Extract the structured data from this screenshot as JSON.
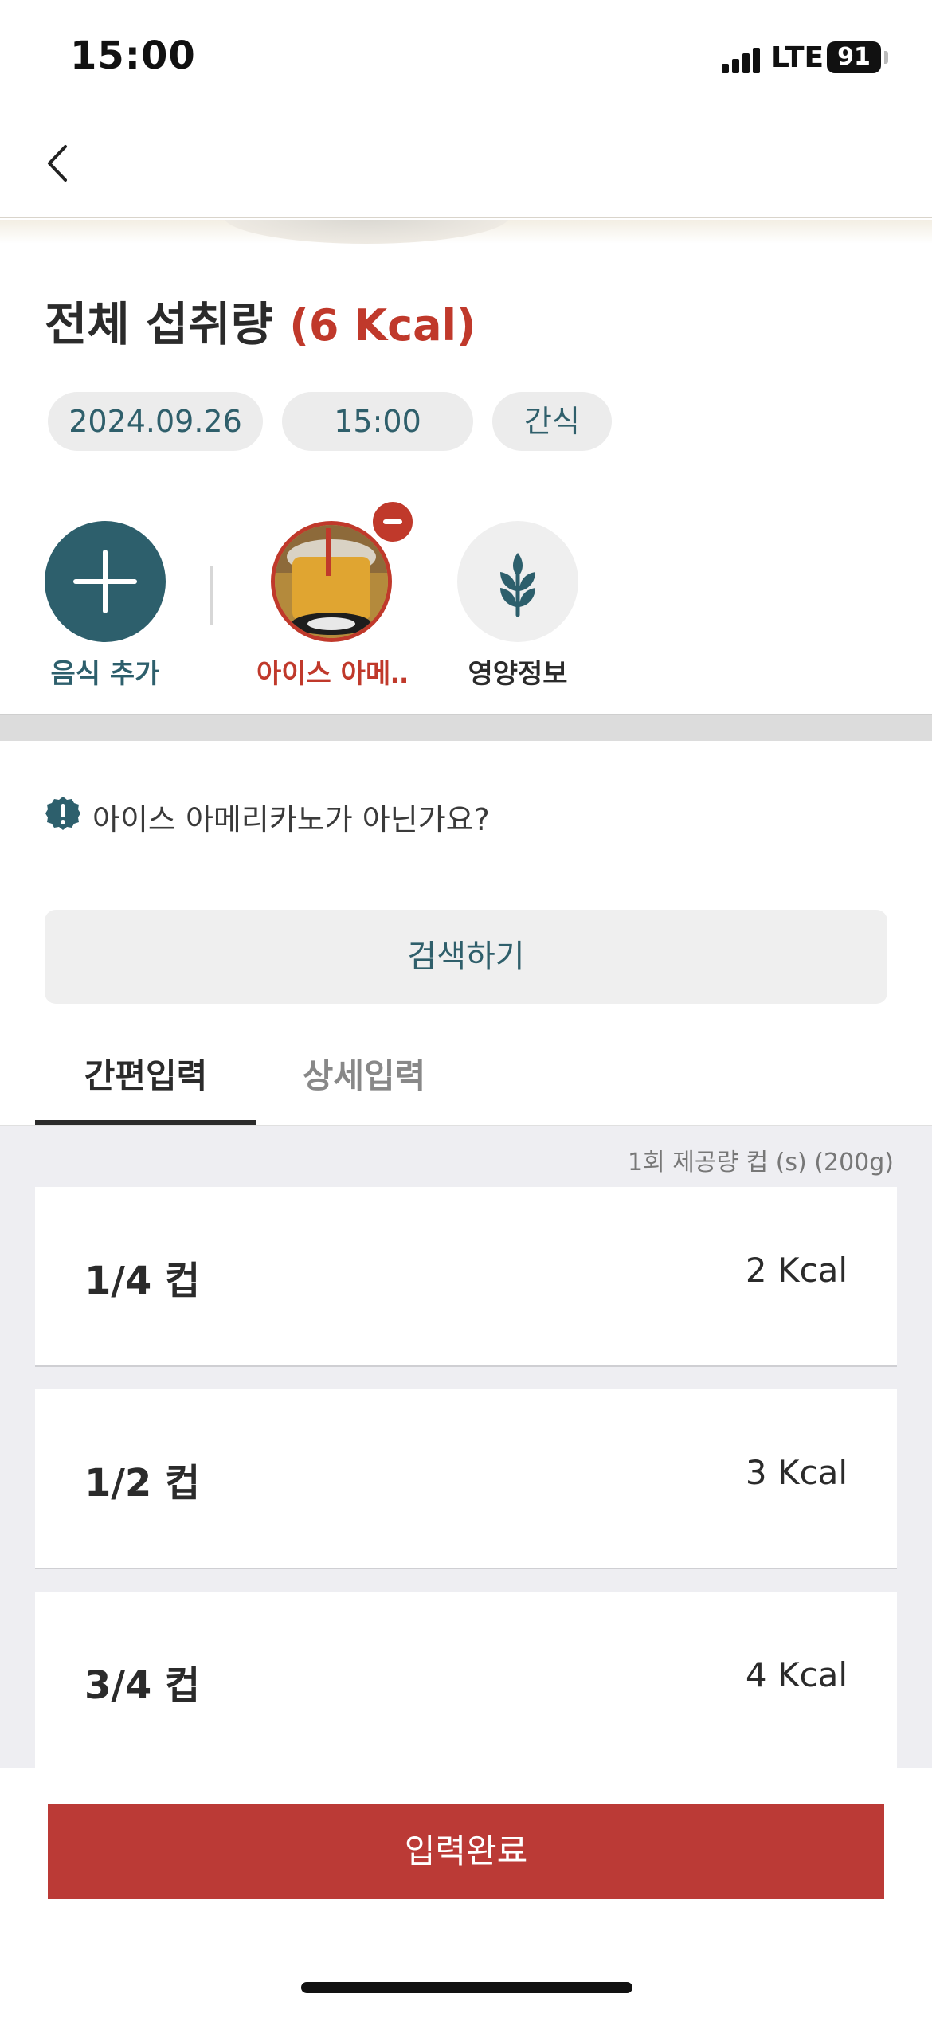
{
  "status_bar": {
    "time": "15:00",
    "network": "LTE",
    "battery": "91"
  },
  "header": {
    "title_prefix": "전체 섭취량",
    "title_kcal": "(6 Kcal)"
  },
  "chips": {
    "date": "2024.09.26",
    "time": "15:00",
    "meal_type": "간식"
  },
  "foods": {
    "add_label": "음식 추가",
    "item_label": "아이스 아메…",
    "nutrition_label": "영양정보"
  },
  "notice": {
    "text": "아이스 아메리카노가 아닌가요?"
  },
  "search": {
    "label": "검색하기"
  },
  "tabs": [
    {
      "label": "간편입력",
      "active": true
    },
    {
      "label": "상세입력",
      "active": false
    }
  ],
  "serving_note": "1회 제공량  컵 (s) (200g)",
  "portions": [
    {
      "label": "1/4 컵",
      "kcal": "2 Kcal"
    },
    {
      "label": "1/2 컵",
      "kcal": "3 Kcal"
    },
    {
      "label": "3/4 컵",
      "kcal": "4 Kcal"
    }
  ],
  "footer": {
    "submit_label": "입력완료"
  },
  "colors": {
    "accent_red": "#c0392b",
    "teal": "#2d5f6c",
    "chip_bg": "#ececec"
  }
}
